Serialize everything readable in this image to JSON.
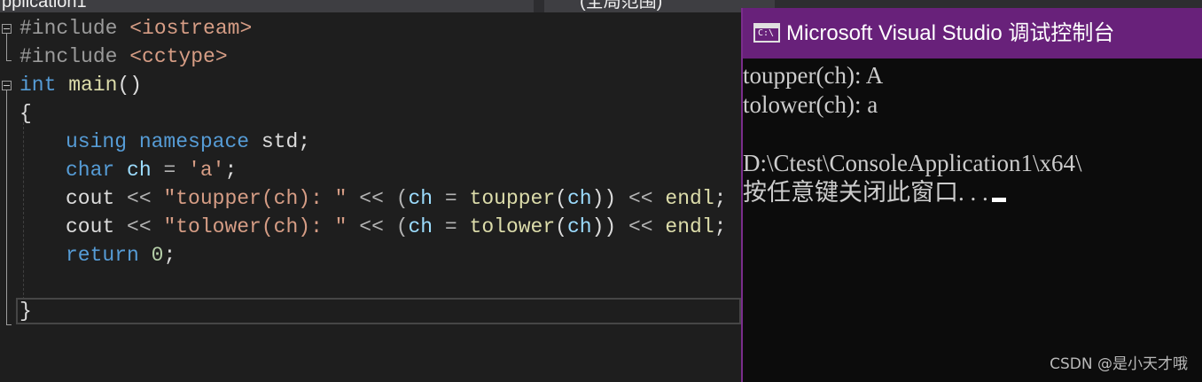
{
  "tabs": {
    "left_partial": "pplication1",
    "right_partial": "(全局范围)"
  },
  "editor": {
    "lines": {
      "l1": {
        "pp": "#include",
        "hdr": "<iostream>"
      },
      "l2": {
        "pp": "#include",
        "hdr": "<cctype>"
      },
      "l3": {
        "kw": "int",
        "name": " main",
        "rest": "()"
      },
      "l4": {
        "brace": "{"
      },
      "l5": {
        "kw1": "using",
        "kw2": "namespace",
        "rest": " std;"
      },
      "l6": {
        "kw": "char",
        "var": "ch",
        "op": " = ",
        "str": "'a'",
        "end": ";"
      },
      "l7": {
        "cout": "cout",
        "op1": " << ",
        "str": "\"toupper(ch): \"",
        "op2": " << (",
        "var1": "ch",
        "op3": " = ",
        "fn": "toupper",
        "p1": "(",
        "var2": "ch",
        "p2": "))",
        "op4": " << ",
        "endl": "endl",
        "end": ";"
      },
      "l8": {
        "cout": "cout",
        "op1": " << ",
        "str": "\"tolower(ch): \"",
        "op2": " << (",
        "var1": "ch",
        "op3": " = ",
        "fn": "tolower",
        "p1": "(",
        "var2": "ch",
        "p2": "))",
        "op4": " << ",
        "endl": "endl",
        "end": ";"
      },
      "l9": {
        "kw": "return",
        "num": "0",
        "end": ";"
      },
      "l11": {
        "brace": "}"
      }
    }
  },
  "console": {
    "title": "Microsoft Visual Studio 调试控制台",
    "icon_text": "C:\\",
    "lines": [
      "toupper(ch): A",
      "tolower(ch): a",
      "",
      "D:\\Ctest\\ConsoleApplication1\\x64\\",
      "按任意键关闭此窗口. . ."
    ]
  },
  "watermark": "CSDN @是小天才哦",
  "colors": {
    "titlebar": "#68217a",
    "editor_bg": "#1e1e1e",
    "console_bg": "#0c0c0c",
    "keyword": "#569cd6",
    "string": "#d69d85",
    "variable": "#9cdcfe",
    "function": "#dcdcaa",
    "number": "#b5cea8"
  }
}
